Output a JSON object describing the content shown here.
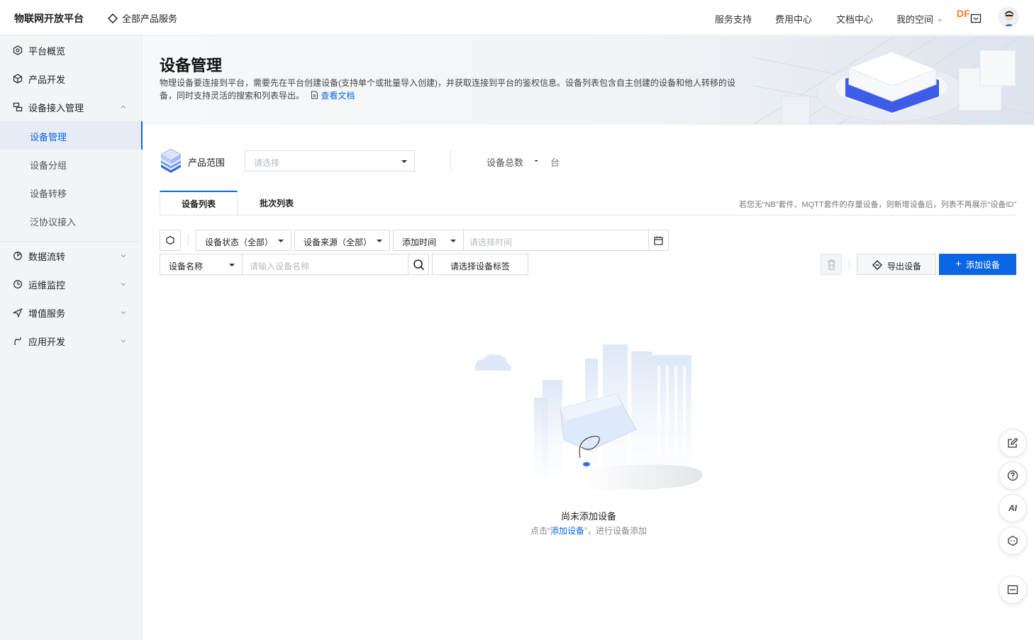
{
  "header": {
    "logo": "物联网开放平台",
    "all_products": "全部产品服务",
    "nav": [
      "服务支持",
      "费用中心",
      "文档中心",
      "我的空间"
    ],
    "df_badge": "DF",
    "accent": "#0b66e4"
  },
  "sidebar": {
    "items": [
      {
        "label": "平台概览",
        "icon": "overview-icon"
      },
      {
        "label": "产品开发",
        "icon": "cube-icon"
      },
      {
        "label": "设备接入管理",
        "icon": "device-access-icon"
      },
      {
        "label": "数据流转",
        "icon": "data-flow-icon"
      },
      {
        "label": "运维监控",
        "icon": "monitor-icon"
      },
      {
        "label": "增值服务",
        "icon": "send-icon"
      },
      {
        "label": "应用开发",
        "icon": "app-dev-icon"
      }
    ],
    "subitems": [
      "设备管理",
      "设备分组",
      "设备转移",
      "泛协议接入"
    ],
    "active_subitem": "设备管理"
  },
  "banner": {
    "title": "设备管理",
    "description": "物理设备要连接到平台，需要先在平台创建设备(支持单个或批量导入创建)，并获取连接到平台的鉴权信息。设备列表包含自主创建的设备和他人转移的设备，同时支持灵活的搜索和列表导出。",
    "doc_link": "查看文档"
  },
  "product_range": {
    "label": "产品范围",
    "placeholder": "请选择",
    "total_label": "设备总数",
    "total_value": "-",
    "unit": "台"
  },
  "tabs": [
    "设备列表",
    "批次列表"
  ],
  "tabs_hint": "若您无“NB”套件、MQTT套件的存量设备，则新增设备后，列表不再展示“设备ID”",
  "filters": {
    "status": "设备状态（全部）",
    "source": "设备来源（全部）",
    "time_field": "添加时间",
    "time_placeholder": "请选择时间",
    "name_field": "设备名称",
    "name_placeholder": "请输入设备名称",
    "tag_placeholder": "请选择设备标签"
  },
  "actions": {
    "export": "导出设备",
    "add": "添加设备"
  },
  "empty": {
    "title": "尚未添加设备",
    "sub_prefix": "点击“",
    "sub_link": "添加设备",
    "sub_suffix": "”，进行设备添加"
  },
  "float_buttons": {
    "ai_label": "AI"
  }
}
